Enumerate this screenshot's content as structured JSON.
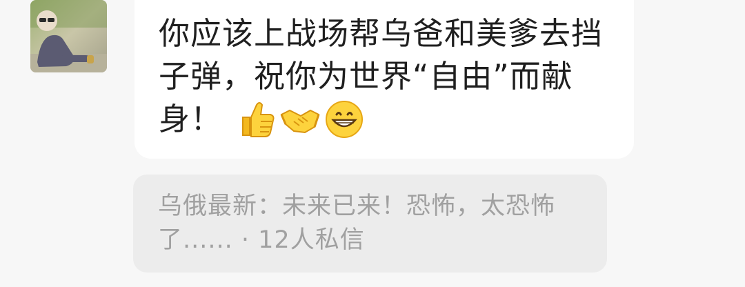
{
  "message": {
    "line1": "你应该上战场帮乌爸和美爹去挡",
    "line2": "子弹，祝你为世界“自由”而献",
    "line3": "身！",
    "emojis": [
      "thumbs-up-icon",
      "handshake-icon",
      "grinning-face-icon"
    ]
  },
  "quote": {
    "line1": "乌俄最新：未来已来！恐怖，太恐怖",
    "line2": "了......",
    "separator": " · ",
    "dm_count": "12人私信"
  },
  "colors": {
    "bubble": "#ffffff",
    "page_bg": "#f7f7f7",
    "quote_bg": "#ececec",
    "quote_text": "#a0a0a0",
    "message_text": "#1f1f1f",
    "emoji_yellow": "#f7c12b"
  }
}
